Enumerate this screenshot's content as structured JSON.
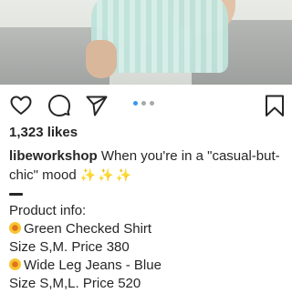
{
  "post": {
    "likes": "1,323 likes",
    "username": "libeworkshop",
    "caption_text": "When you're in a \"casual-but-chic\" mood",
    "sparkles": "✨✨✨",
    "details": {
      "heading": "Product info:",
      "item1_name": "Green Checked Shirt",
      "item1_detail": "Size S,M. Price 380",
      "item2_name": "Wide Leg Jeans - Blue",
      "item2_detail": "Size S,M,L. Price 520"
    }
  },
  "actions": {
    "like_icon": "heart-icon",
    "comment_icon": "comment-icon",
    "share_icon": "send-icon",
    "save_icon": "bookmark-icon",
    "carousel_count": 3,
    "carousel_active": 0
  },
  "colors": {
    "text": "#262626",
    "carousel_active": "#3897f0",
    "carousel_inactive": "#a8a8a8"
  }
}
